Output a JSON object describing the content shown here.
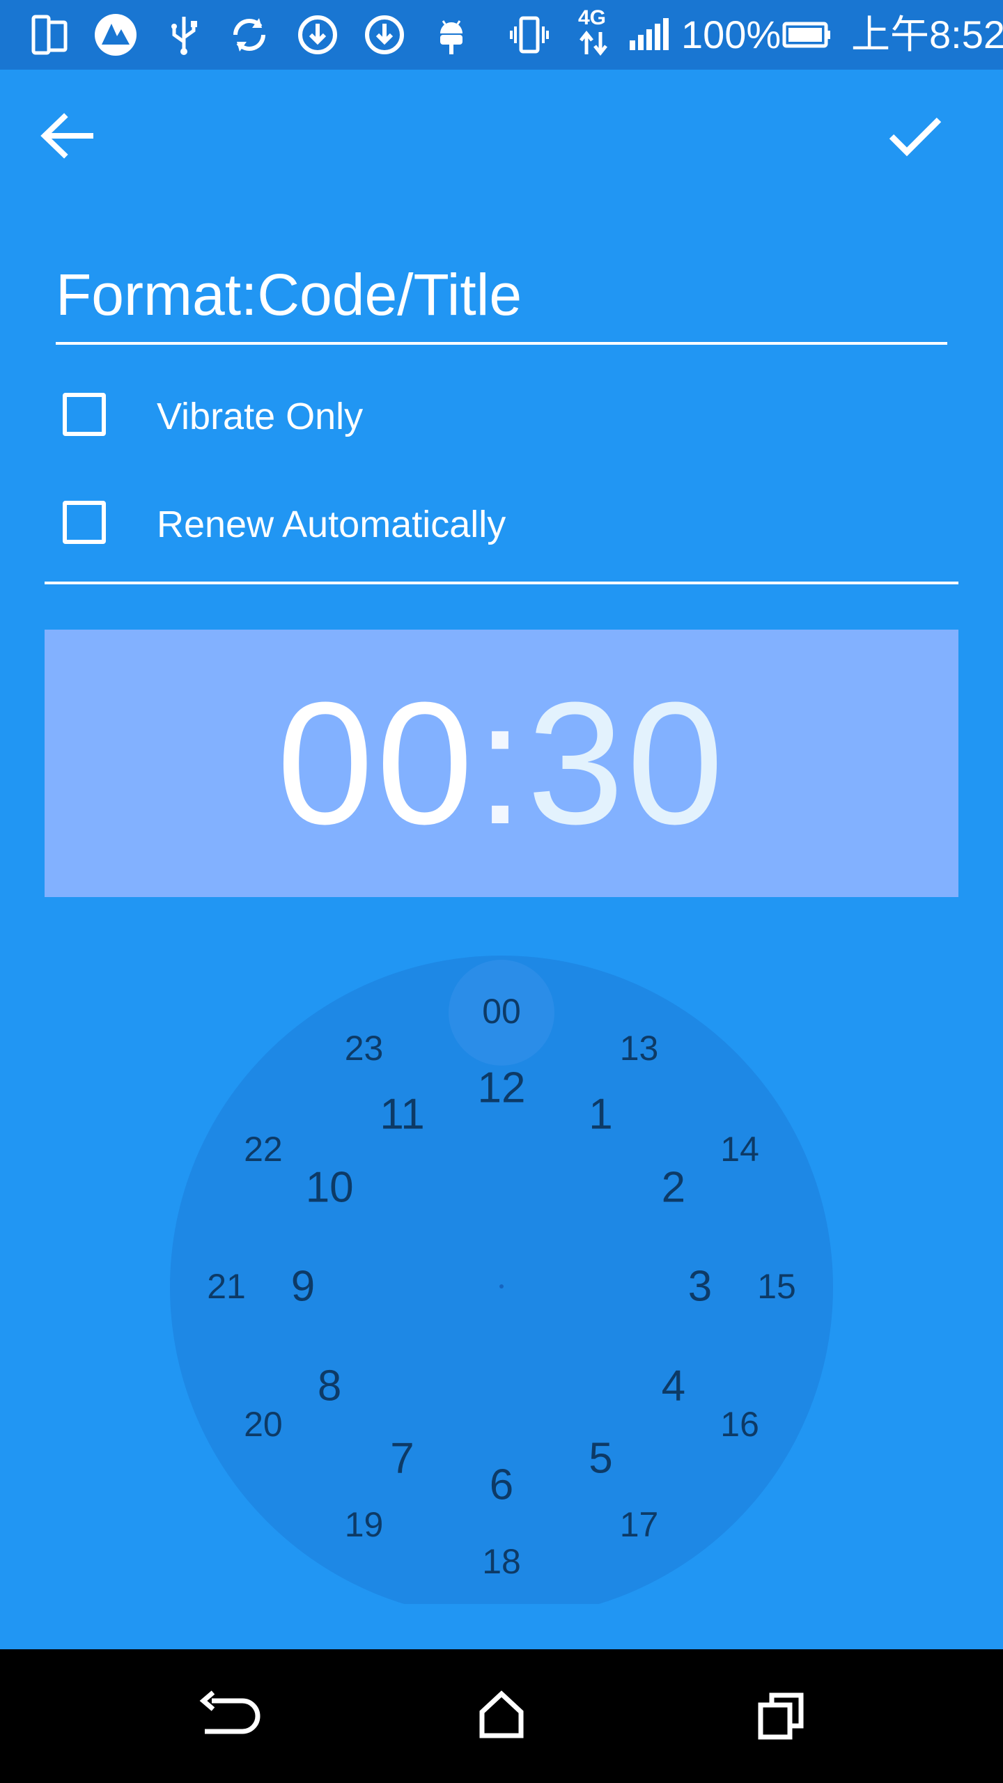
{
  "status_bar": {
    "battery_text": "100%",
    "time_text": "上午8:52",
    "network_text": "4G",
    "icons": [
      "phone-screen-icon",
      "app-logo-icon",
      "usb-icon",
      "sync-icon",
      "download-icon",
      "download-icon",
      "sync-download-icon",
      "android-icon",
      "vibrate-icon",
      "signal-icon",
      "battery-icon"
    ]
  },
  "toolbar": {
    "back_icon": "arrow-left-icon",
    "confirm_icon": "check-icon"
  },
  "title_field": {
    "value": "",
    "placeholder": "Format:Code/Title"
  },
  "options": {
    "vibrate_only": {
      "label": "Vibrate Only",
      "checked": false
    },
    "renew_automatically": {
      "label": "Renew Automatically",
      "checked": false
    }
  },
  "time_display": {
    "hours": "00",
    "separator": ":",
    "minutes": "30"
  },
  "clock": {
    "selected": "00",
    "inner_numbers": [
      "12",
      "1",
      "2",
      "3",
      "4",
      "5",
      "6",
      "7",
      "8",
      "9",
      "10",
      "11"
    ],
    "outer_numbers": [
      "00",
      "13",
      "14",
      "15",
      "16",
      "17",
      "18",
      "19",
      "20",
      "21",
      "22",
      "23"
    ]
  },
  "nav_bar": {
    "back_icon": "nav-back-icon",
    "home_icon": "nav-home-icon",
    "recents_icon": "nav-recents-icon"
  },
  "colors": {
    "primary": "#2196F3",
    "primary_dark": "#1976D2",
    "time_panel": "#82B1FF",
    "clock_face": "#1E88E5",
    "clock_text": "#0D3A66"
  }
}
